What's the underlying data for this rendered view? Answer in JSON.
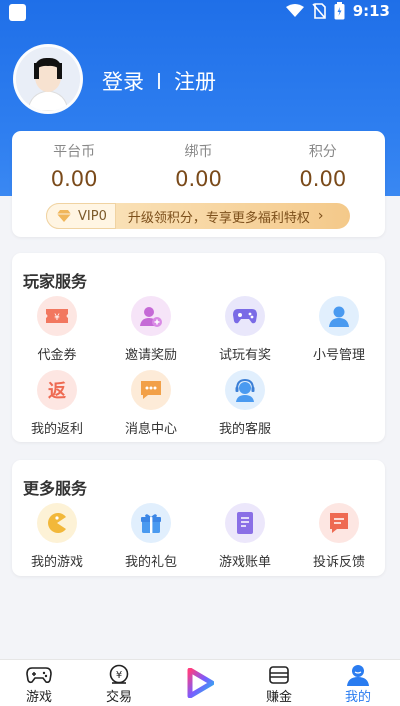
{
  "status_bar": {
    "time": "9:13"
  },
  "user": {
    "login": "登录",
    "register": "注册"
  },
  "coins": [
    {
      "label": "平台币",
      "value": "0.00"
    },
    {
      "label": "绑币",
      "value": "0.00"
    },
    {
      "label": "积分",
      "value": "0.00"
    }
  ],
  "vip": {
    "level": "VIP0",
    "promo": "升级领积分，专享更多福利特权",
    "arrow": "›"
  },
  "player_services": {
    "title": "玩家服务",
    "items": [
      {
        "label": "代金券",
        "icon": "voucher-icon"
      },
      {
        "label": "邀请奖励",
        "icon": "invite-icon"
      },
      {
        "label": "试玩有奖",
        "icon": "gamepad-icon"
      },
      {
        "label": "小号管理",
        "icon": "user-account-icon"
      },
      {
        "label": "我的返利",
        "icon": "rebate-icon"
      },
      {
        "label": "消息中心",
        "icon": "message-icon"
      },
      {
        "label": "我的客服",
        "icon": "customer-service-icon"
      }
    ]
  },
  "more_services": {
    "title": "更多服务",
    "items": [
      {
        "label": "我的游戏",
        "icon": "pacman-icon"
      },
      {
        "label": "我的礼包",
        "icon": "gift-icon"
      },
      {
        "label": "游戏账单",
        "icon": "bill-icon"
      },
      {
        "label": "投诉反馈",
        "icon": "feedback-icon"
      }
    ]
  },
  "tabbar": {
    "games": "游戏",
    "trade": "交易",
    "earn": "赚金",
    "mine": "我的"
  },
  "colors": {
    "accent": "#2a7cf0",
    "header": "#2f7ff0",
    "coin_value": "#7a4a1a"
  }
}
